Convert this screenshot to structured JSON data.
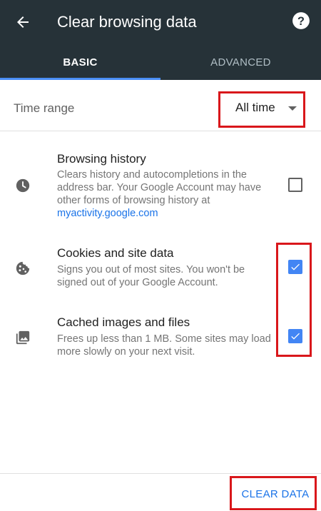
{
  "header": {
    "title": "Clear browsing data",
    "back_icon": "arrow-back-icon",
    "help_icon": "help-icon",
    "background": "#263238"
  },
  "tabs": [
    {
      "label": "BASIC",
      "selected": true
    },
    {
      "label": "ADVANCED",
      "selected": false
    }
  ],
  "time_range": {
    "label": "Time range",
    "value": "All time"
  },
  "items": [
    {
      "title": "Browsing history",
      "description": "Clears history and autocompletions in the address bar. Your Google Account may have other forms of browsing history at",
      "link": "myactivity.google.com",
      "icon": "clock-icon",
      "checked": false
    },
    {
      "title": "Cookies and site data",
      "description": "Signs you out of most sites. You won't be signed out of your Google Account.",
      "icon": "cookie-icon",
      "checked": true
    },
    {
      "title": "Cached images and files",
      "description": "Frees up less than 1 MB. Some sites may load more slowly on your next visit.",
      "icon": "image-icon",
      "checked": true
    }
  ],
  "footer": {
    "clear_label": "CLEAR DATA"
  },
  "colors": {
    "accent": "#4285f4",
    "link": "#1a73e8",
    "highlight": "#d9171b"
  }
}
